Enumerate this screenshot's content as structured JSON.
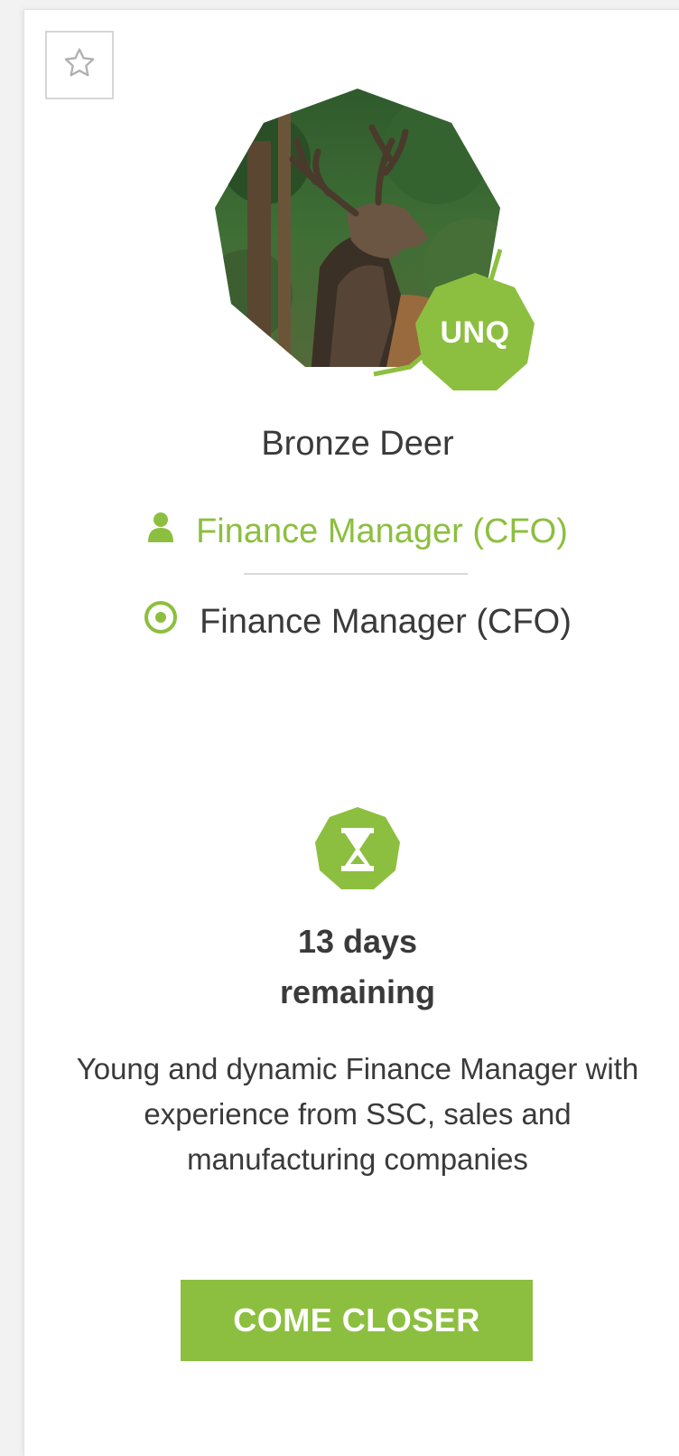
{
  "candidate": {
    "name": "Bronze Deer",
    "badge": "UNQ",
    "current_role": "Finance Manager (CFO)",
    "target_role": "Finance Manager (CFO)",
    "remaining_count": "13 days",
    "remaining_label": "remaining",
    "description": "Young and dynamic Finance Manager with experience from SSC, sales and manufacturing companies",
    "cta_label": "COME CLOSER"
  },
  "icons": {
    "favorite": "star-outline-icon",
    "current_role": "person-icon",
    "target_role": "target-icon",
    "timer": "hourglass-icon"
  },
  "colors": {
    "accent": "#8cbf3f",
    "text": "#3a3a3a"
  }
}
